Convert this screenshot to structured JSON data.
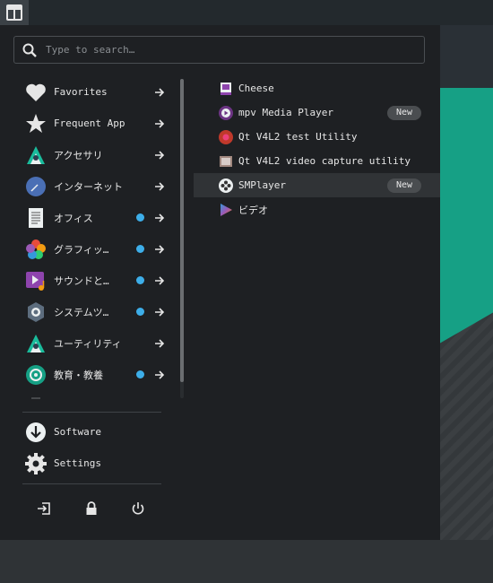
{
  "search": {
    "placeholder": "Type to search…"
  },
  "categories": [
    {
      "label": "Favorites",
      "icon": "heart-icon",
      "dot": false
    },
    {
      "label": "Frequent Apps",
      "icon": "star-icon",
      "dot": false
    },
    {
      "label": "アクセサリ",
      "icon": "accessories-icon",
      "dot": false
    },
    {
      "label": "インターネット",
      "icon": "internet-icon",
      "dot": false
    },
    {
      "label": "オフィス",
      "icon": "office-icon",
      "dot": true
    },
    {
      "label": "グラフィッ…",
      "icon": "graphics-icon",
      "dot": true
    },
    {
      "label": "サウンドと…",
      "icon": "multimedia-icon",
      "dot": true
    },
    {
      "label": "システムツ…",
      "icon": "system-tools-icon",
      "dot": true
    },
    {
      "label": "ユーティリティ",
      "icon": "utilities-icon",
      "dot": false
    },
    {
      "label": "教育・教養",
      "icon": "education-icon",
      "dot": true
    }
  ],
  "system": {
    "software_label": "Software",
    "settings_label": "Settings"
  },
  "apps": [
    {
      "label": "Cheese",
      "icon": "cheese-icon",
      "badge": ""
    },
    {
      "label": "mpv Media Player",
      "icon": "mpv-icon",
      "badge": "New"
    },
    {
      "label": "Qt V4L2 test Utility",
      "icon": "qv4l2-icon",
      "badge": ""
    },
    {
      "label": "Qt V4L2 video capture utility",
      "icon": "qvidcap-icon",
      "badge": ""
    },
    {
      "label": "SMPlayer",
      "icon": "smplayer-icon",
      "badge": "New"
    },
    {
      "label": "ビデオ",
      "icon": "video-icon",
      "badge": ""
    }
  ],
  "colors": {
    "accent": "#3daee9",
    "teal": "#16a085",
    "menu_bg": "#1e2023"
  }
}
